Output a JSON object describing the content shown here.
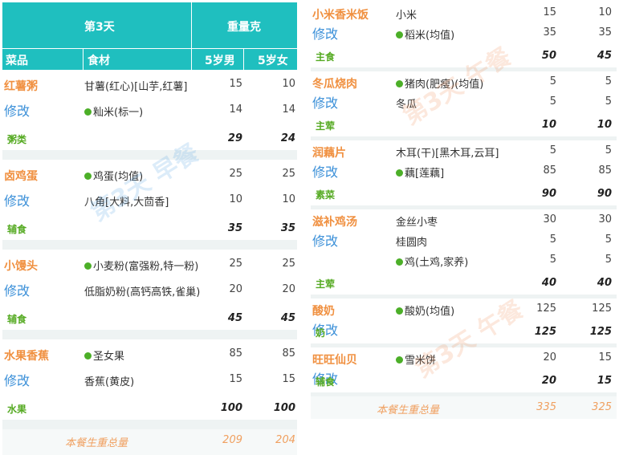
{
  "header": {
    "day": "第3天",
    "weight": "重量克",
    "col_dish": "菜品",
    "col_ingredient": "食材",
    "col_boy": "5岁男",
    "col_girl": "5岁女"
  },
  "edit_label": "修改",
  "left": {
    "watermark": "第3天 早餐",
    "dishes": [
      {
        "name": "红薯粥",
        "category": "粥类",
        "items": [
          {
            "name": "甘薯(红心)[山芋,红薯]",
            "dot": false,
            "boy": "15",
            "girl": "10"
          },
          {
            "name": "籼米(标一)",
            "dot": true,
            "boy": "14",
            "girl": "14"
          }
        ],
        "total_boy": "29",
        "total_girl": "24"
      },
      {
        "name": "卤鸡蛋",
        "category": "辅食",
        "items": [
          {
            "name": "鸡蛋(均值)",
            "dot": true,
            "boy": "25",
            "girl": "25"
          },
          {
            "name": "八角[大料,大茴香]",
            "dot": false,
            "boy": "10",
            "girl": "10"
          }
        ],
        "total_boy": "35",
        "total_girl": "35"
      },
      {
        "name": "小馒头",
        "category": "辅食",
        "items": [
          {
            "name": "小麦粉(富强粉,特一粉)",
            "dot": true,
            "boy": "25",
            "girl": "25"
          },
          {
            "name": "低脂奶粉(高钙高铁,雀巢)",
            "dot": false,
            "boy": "20",
            "girl": "20"
          }
        ],
        "total_boy": "45",
        "total_girl": "45"
      },
      {
        "name": "水果香蕉",
        "category": "水果",
        "items": [
          {
            "name": "圣女果",
            "dot": true,
            "boy": "85",
            "girl": "85"
          },
          {
            "name": "香蕉(黄皮)",
            "dot": false,
            "boy": "15",
            "girl": "15"
          }
        ],
        "total_boy": "100",
        "total_girl": "100"
      }
    ],
    "footer": {
      "label": "本餐生重总量",
      "boy": "209",
      "girl": "204"
    }
  },
  "right": {
    "watermark": "第3天 午餐",
    "dishes": [
      {
        "name": "小米香米饭",
        "category": "主食",
        "items": [
          {
            "name": "小米",
            "dot": false,
            "boy": "15",
            "girl": "10"
          },
          {
            "name": "稻米(均值)",
            "dot": true,
            "boy": "35",
            "girl": "35"
          }
        ],
        "total_boy": "50",
        "total_girl": "45"
      },
      {
        "name": "冬瓜烧肉",
        "category": "主荤",
        "items": [
          {
            "name": "猪肉(肥瘦)(均值)",
            "dot": true,
            "boy": "5",
            "girl": "5"
          },
          {
            "name": "冬瓜",
            "dot": false,
            "boy": "5",
            "girl": "5"
          }
        ],
        "total_boy": "10",
        "total_girl": "10"
      },
      {
        "name": "润藕片",
        "category": "素菜",
        "items": [
          {
            "name": "木耳(干)[黑木耳,云耳]",
            "dot": false,
            "boy": "5",
            "girl": "5"
          },
          {
            "name": "藕[莲藕]",
            "dot": true,
            "boy": "85",
            "girl": "85"
          }
        ],
        "total_boy": "90",
        "total_girl": "90"
      },
      {
        "name": "滋补鸡汤",
        "category": "主荤",
        "items": [
          {
            "name": "金丝小枣",
            "dot": false,
            "boy": "30",
            "girl": "30"
          },
          {
            "name": "桂圆肉",
            "dot": false,
            "boy": "5",
            "girl": "5"
          },
          {
            "name": "鸡(土鸡,家养)",
            "dot": true,
            "boy": "5",
            "girl": "5"
          }
        ],
        "total_boy": "40",
        "total_girl": "40"
      },
      {
        "name": "酸奶",
        "category": "奶",
        "items": [
          {
            "name": "酸奶(均值)",
            "dot": true,
            "boy": "125",
            "girl": "125"
          }
        ],
        "total_boy": "125",
        "total_girl": "125"
      },
      {
        "name": "旺旺仙贝",
        "category": "辅食",
        "items": [
          {
            "name": "雪米饼",
            "dot": true,
            "boy": "20",
            "girl": "15"
          }
        ],
        "total_boy": "20",
        "total_girl": "15"
      }
    ],
    "footer": {
      "label": "本餐生重总量",
      "boy": "335",
      "girl": "325"
    }
  }
}
